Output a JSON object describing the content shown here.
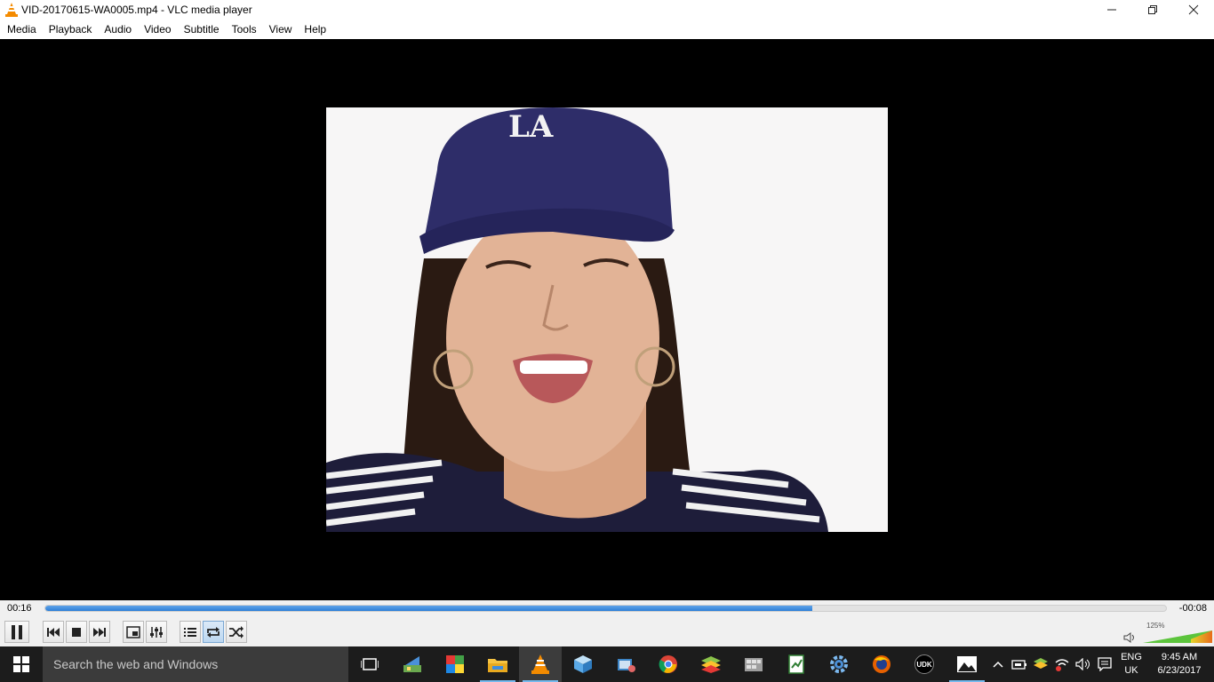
{
  "window": {
    "title": "VID-20170615-WA0005.mp4 - VLC media player",
    "minimize_icon": "minimize-icon",
    "maximize_icon": "restore-icon",
    "close_icon": "close-icon"
  },
  "menu": {
    "items": [
      "Media",
      "Playback",
      "Audio",
      "Video",
      "Subtitle",
      "Tools",
      "View",
      "Help"
    ]
  },
  "video": {
    "logo_text": "LA"
  },
  "seek": {
    "elapsed": "00:16",
    "remaining": "-00:08",
    "progress": 0.684
  },
  "controls": {
    "buttons": [
      {
        "name": "pause-button",
        "icon": "pause-icon"
      },
      {
        "name": "previous-button",
        "icon": "skip-back-icon"
      },
      {
        "name": "stop-button",
        "icon": "stop-icon"
      },
      {
        "name": "next-button",
        "icon": "skip-forward-icon"
      },
      {
        "name": "fullscreen-button",
        "icon": "fullscreen-icon"
      },
      {
        "name": "extended-settings-button",
        "icon": "equalizer-icon"
      },
      {
        "name": "playlist-button",
        "icon": "playlist-icon"
      },
      {
        "name": "loop-button",
        "icon": "loop-icon"
      },
      {
        "name": "random-button",
        "icon": "shuffle-icon"
      }
    ],
    "volume_percent": "125%",
    "volume_level": 1.25
  },
  "taskbar": {
    "search_placeholder": "Search the web and Windows",
    "pinned": [
      "task-view-icon",
      "app-icon",
      "store-icon",
      "file-explorer-icon",
      "vlc-icon",
      "box-icon",
      "app-icon",
      "chrome-icon",
      "bluestacks-icon",
      "app-icon",
      "spreadsheet-icon",
      "settings-icon",
      "firefox-icon",
      "udk-icon",
      "photos-icon"
    ],
    "udk_label": "UDK",
    "language_line1": "ENG",
    "language_line2": "UK",
    "time": "9:45 AM",
    "date": "6/23/2017",
    "colors": {
      "taskbar_bg": "#1c1c1c",
      "accent": "#2d7fd6",
      "running_indicator": "#76b9ed"
    }
  }
}
